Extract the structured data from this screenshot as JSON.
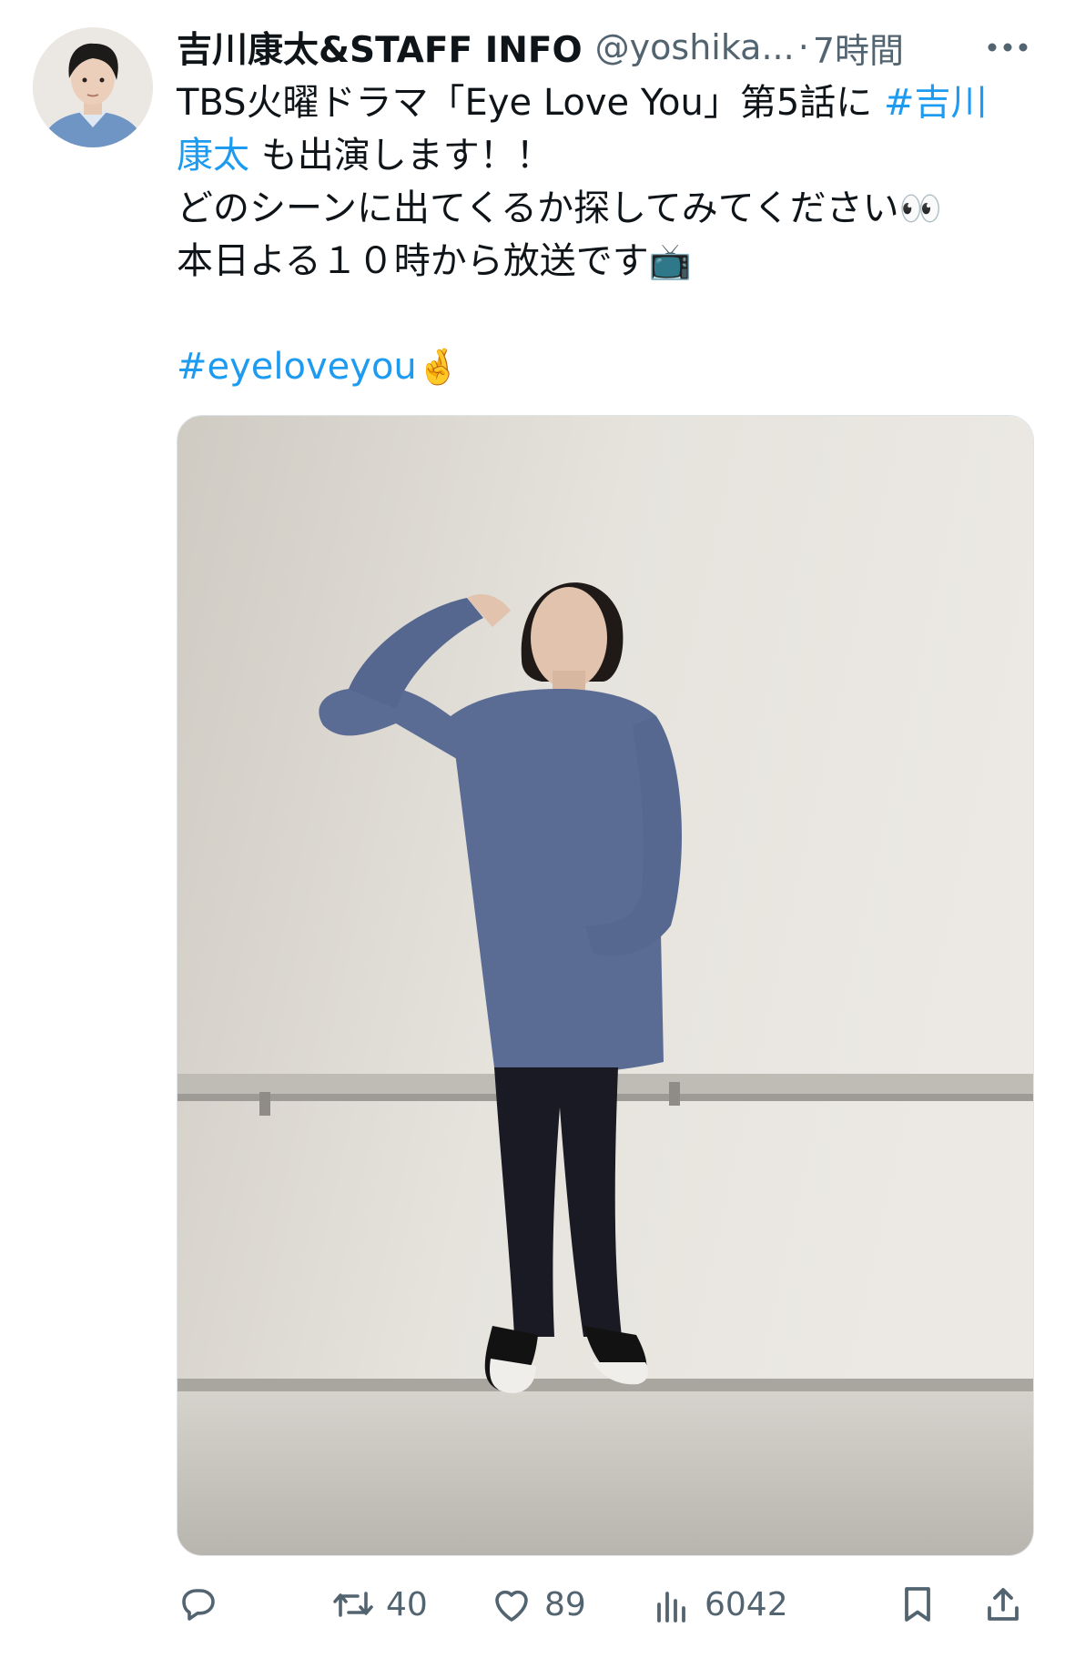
{
  "tweet": {
    "display_name": "吉川康太&STAFF INFO",
    "handle": "@yoshika...",
    "separator": "·",
    "time": "7時間",
    "more_icon": "more-horizontal-icon",
    "lines": [
      {
        "text": "TBS火曜ドラマ「Eye Love You」第5話に ",
        "link": "#吉川"
      },
      {
        "link": "康太",
        "text": " も出演します！！"
      },
      {
        "text": "どのシーンに出てくるか探してみてください",
        "emoji": "👀"
      },
      {
        "text": "本日よる１０時から放送です",
        "emoji": "📺"
      },
      {
        "link": "#eyeloveyou",
        "emoji": "🤞"
      }
    ]
  },
  "actions": {
    "reply": {
      "icon": "reply-icon",
      "count": ""
    },
    "retweet": {
      "icon": "retweet-icon",
      "count": "40"
    },
    "like": {
      "icon": "heart-icon",
      "count": "89"
    },
    "views": {
      "icon": "views-chart-icon",
      "count": "6042"
    },
    "bookmark": {
      "icon": "bookmark-icon"
    },
    "share": {
      "icon": "share-icon"
    }
  },
  "colors": {
    "link": "#1d9bf0",
    "text": "#0f1419",
    "secondary": "#536471"
  }
}
